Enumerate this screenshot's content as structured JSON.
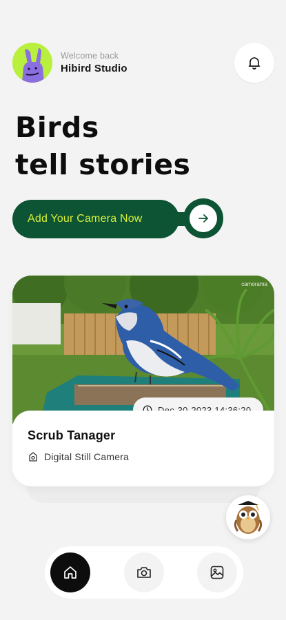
{
  "header": {
    "welcome": "Welcome back",
    "studio_name": "Hibird Studio",
    "avatar_icon": "rabbit-avatar-icon",
    "notification_icon": "bell-icon"
  },
  "hero": {
    "line1": "Birds",
    "line2": "tell stories"
  },
  "cta": {
    "label": "Add Your Camera Now",
    "icon": "arrow-right-icon"
  },
  "card": {
    "watermark": "camorama",
    "timestamp": "Dec-30-2023 14:36:20",
    "bird_name": "Scrub Tanager",
    "camera_label": "Digital Still Camera"
  },
  "nav": {
    "items": [
      "home-icon",
      "camera-icon",
      "gallery-icon"
    ],
    "active": "home-icon"
  },
  "colors": {
    "accent_green": "#0c5433",
    "accent_lime": "#d8ef3a",
    "avatar_bg": "#b9ef3d",
    "background": "#f3f3f3"
  }
}
